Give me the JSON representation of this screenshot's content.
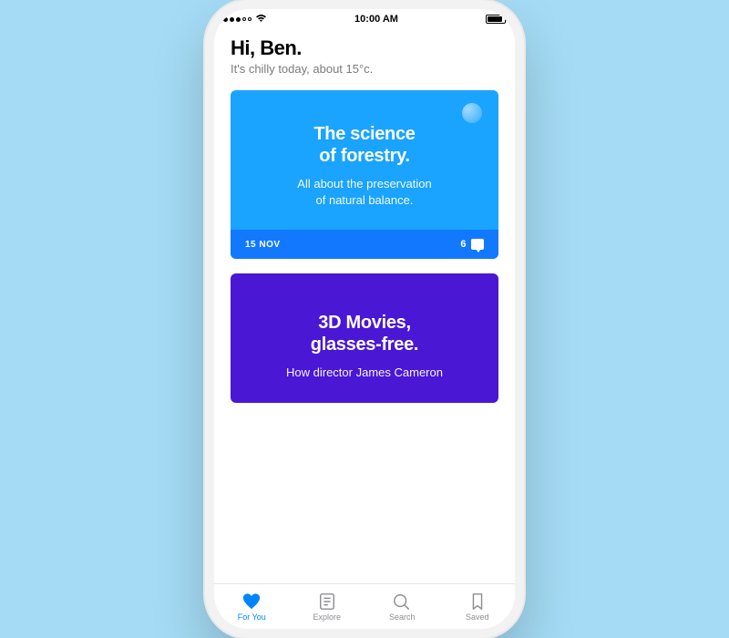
{
  "status": {
    "time": "10:00 AM"
  },
  "header": {
    "greeting": "Hi, Ben.",
    "subgreeting": "It's chilly today, about 15°c."
  },
  "cards": [
    {
      "title_l1": "The science",
      "title_l2": "of forestry.",
      "subtitle_l1": "All about the preservation",
      "subtitle_l2": "of natural balance.",
      "date": "15 NOV",
      "comments": "6",
      "bg": "#1aa3ff",
      "footer_bg": "#1279ff"
    },
    {
      "title_l1": "3D Movies,",
      "title_l2": "glasses-free.",
      "subtitle_l1": "How director James Cameron",
      "bg": "#4a17d4"
    }
  ],
  "tabs": [
    {
      "label": "For You"
    },
    {
      "label": "Explore"
    },
    {
      "label": "Search"
    },
    {
      "label": "Saved"
    }
  ]
}
